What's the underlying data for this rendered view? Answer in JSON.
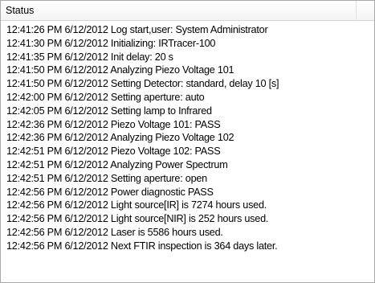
{
  "status_panel": {
    "header_label": "Status",
    "lines": [
      "12:41:26 PM 6/12/2012 Log start,user: System Administrator",
      "12:41:30 PM 6/12/2012 Initializing: IRTracer-100",
      "12:41:35 PM 6/12/2012 Init delay: 20 s",
      "12:41:50 PM 6/12/2012 Analyzing Piezo Voltage 101",
      "12:41:50 PM 6/12/2012 Setting Detector: standard, delay 10 [s]",
      "12:42:00 PM 6/12/2012 Setting aperture: auto",
      "12:42:05 PM 6/12/2012 Setting lamp to Infrared",
      "12:42:36 PM 6/12/2012 Piezo Voltage 101: PASS",
      "12:42:36 PM 6/12/2012 Analyzing Piezo Voltage 102",
      "12:42:51 PM 6/12/2012 Piezo Voltage 102: PASS",
      "12:42:51 PM 6/12/2012 Analyzing Power Spectrum",
      "12:42:51 PM 6/12/2012 Setting aperture: open",
      "12:42:56 PM 6/12/2012 Power diagnostic PASS",
      "12:42:56 PM 6/12/2012 Light source[IR] is 7274 hours used.",
      "12:42:56 PM 6/12/2012 Light source[NIR] is 252 hours used.",
      "12:42:56 PM 6/12/2012 Laser is 5586 hours used.",
      "12:42:56 PM 6/12/2012 Next FTIR inspection is 364 days later."
    ]
  }
}
